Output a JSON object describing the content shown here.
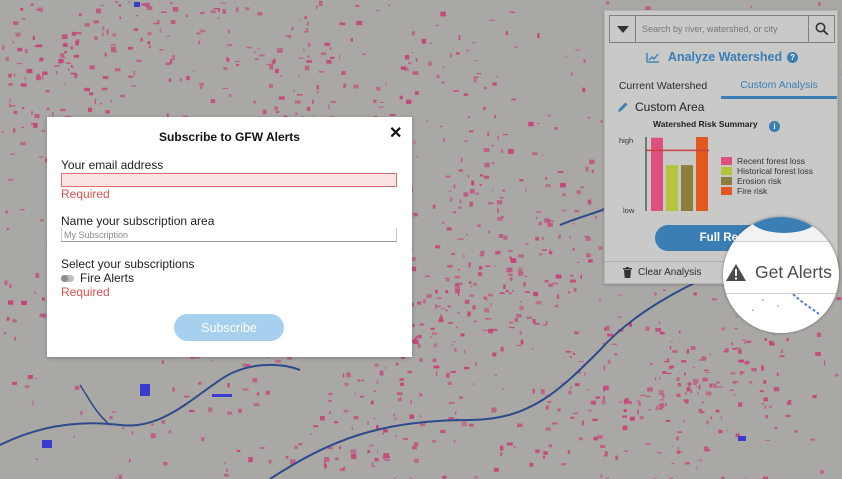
{
  "colors": {
    "map_background": "#a9a8a5",
    "forest_loss": "#c4457a",
    "river": "#2e4a8c",
    "accent": "#3b7db5",
    "required": "#d9534f",
    "subscribe_disabled": "#a7d0ee"
  },
  "panel": {
    "search": {
      "placeholder": "Search by river, watershed, or city",
      "dropdown_icon": "caret-down-icon",
      "search_icon": "magnifier-icon"
    },
    "analyze_label": "Analyze Watershed",
    "analyze_help": "?",
    "tabs": [
      {
        "label": "Current Watershed",
        "active": false
      },
      {
        "label": "Custom Analysis",
        "active": true
      }
    ],
    "custom_area_label": "Custom Area",
    "risk_summary": {
      "title": "Watershed Risk Summary",
      "info": "i",
      "axis_high": "high",
      "axis_low": "low",
      "legend": [
        {
          "label": "Recent forest loss",
          "color": "#e0507f"
        },
        {
          "label": "Historical forest loss",
          "color": "#b5c43a"
        },
        {
          "label": "Erosion risk",
          "color": "#8c7e3a"
        },
        {
          "label": "Fire risk",
          "color": "#e2581f"
        }
      ]
    },
    "full_report_label": "Full Report",
    "clear_label": "Clear Analysis",
    "get_alerts_label": "Get Alerts"
  },
  "chart_data": {
    "type": "bar",
    "title": "Watershed Risk Summary",
    "categories": [
      "Recent forest loss",
      "Historical forest loss",
      "Erosion risk",
      "Fire risk"
    ],
    "values": [
      0.99,
      0.62,
      0.62,
      1.0
    ],
    "ylim": [
      0,
      1
    ],
    "ylabel": "",
    "xlabel": "",
    "threshold": 0.82,
    "tick_labels": [
      "low",
      "high"
    ],
    "legend_placement": "right",
    "grid": false
  },
  "modal": {
    "title": "Subscribe to GFW Alerts",
    "close": "✕",
    "email_label": "Your email address",
    "email_value": "",
    "email_error": "Required",
    "name_label": "Name your subscription area",
    "name_placeholder": "My Subscription",
    "subs_label": "Select your subscriptions",
    "fire_alerts_label": "Fire Alerts",
    "fire_alerts_on": false,
    "subs_error": "Required",
    "subscribe_label": "Subscribe"
  }
}
